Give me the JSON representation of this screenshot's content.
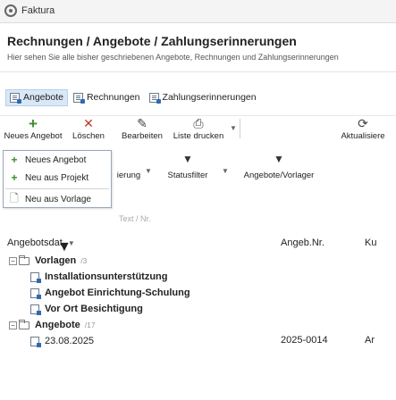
{
  "app": {
    "name": "Faktura"
  },
  "page": {
    "title": "Rechnungen / Angebote / Zahlungserinnerungen",
    "subtitle": "Hier sehen Sie alle bisher geschriebenen Angebote, Rechnungen und Zahlungserinnerungen"
  },
  "tabs": [
    {
      "label": "Angebote",
      "active": true,
      "icon": "document-icon"
    },
    {
      "label": "Rechnungen",
      "active": false,
      "icon": "document-icon"
    },
    {
      "label": "Zahlungserinnerungen",
      "active": false,
      "icon": "document-icon"
    }
  ],
  "toolbar": {
    "new_offer": "Neues Angebot",
    "delete": "Löschen",
    "edit": "Bearbeiten",
    "print_list": "Liste drucken",
    "refresh": "Aktualisiere"
  },
  "toolbar2": {
    "fragment": "ierung",
    "status_filter": "Statusfilter",
    "offer_template": "Angebote/Vorlager"
  },
  "dropdown": {
    "items": [
      {
        "label": "Neues Angebot",
        "icon": "plus-icon"
      },
      {
        "label": "Neu aus Projekt",
        "icon": "plus-icon"
      },
      {
        "label": "Neu aus Vorlage",
        "icon": "document-icon"
      }
    ]
  },
  "grid": {
    "ghost_header": "Text / Nr.",
    "columns": [
      "Angebotsdat.",
      "Angeb.Nr.",
      "Ku"
    ],
    "groups": [
      {
        "label": "Vorlagen",
        "count": "/3",
        "rows": [
          {
            "text": "Installationsunterstützung"
          },
          {
            "text": "Angebot Einrichtung-Schulung"
          },
          {
            "text": "Vor Ort Besichtigung"
          }
        ]
      },
      {
        "label": "Angebote",
        "count": "/17",
        "rows": [
          {
            "date": "23.08.2025",
            "number": "2025-0014",
            "customer": "Ar"
          }
        ]
      }
    ]
  },
  "colors": {
    "accent": "#2e6ab3",
    "active_tab_bg": "#d9e8f7",
    "plus_green": "#3d8b2f",
    "delete_red": "#c0392b"
  }
}
